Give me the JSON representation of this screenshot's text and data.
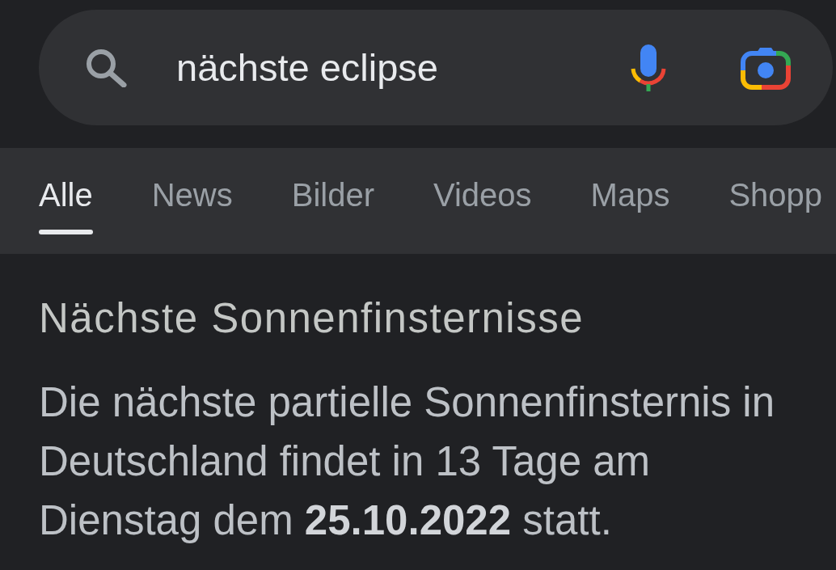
{
  "search": {
    "value": "nächste eclipse"
  },
  "tabs": [
    {
      "label": "Alle",
      "selected": true
    },
    {
      "label": "News",
      "selected": false
    },
    {
      "label": "Bilder",
      "selected": false
    },
    {
      "label": "Videos",
      "selected": false
    },
    {
      "label": "Maps",
      "selected": false
    },
    {
      "label": "Shopp",
      "selected": false
    }
  ],
  "result": {
    "title": "Nächste Sonnenfinsternisse",
    "text": "Die nächste partielle Sonnenfinsternis in Deutschland findet in 13 Tage am Dienstag dem **25.10.2022** statt."
  }
}
